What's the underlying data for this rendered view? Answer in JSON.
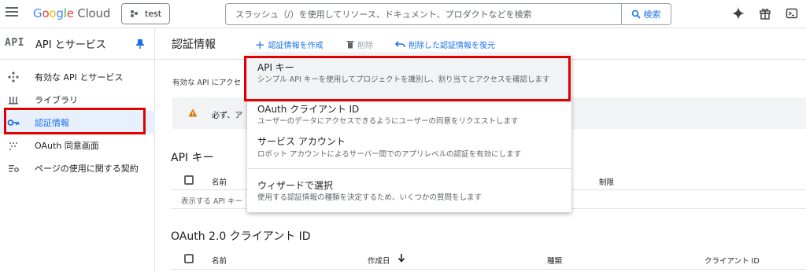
{
  "header": {
    "logo": {
      "G": "G",
      "o1": "o",
      "o2": "o",
      "g": "g",
      "l": "l",
      "e": "e",
      "cloud": "Cloud"
    },
    "project": "test",
    "search_placeholder": "スラッシュ（/）を使用してリソース、ドキュメント、プロダクトなどを検索",
    "search_button": "検索"
  },
  "sidebar": {
    "logo": "API",
    "title": "API とサービス",
    "items": [
      {
        "label": "有効な API とサービス",
        "icon": "api-diamond-icon"
      },
      {
        "label": "ライブラリ",
        "icon": "library-icon"
      },
      {
        "label": "認証情報",
        "icon": "key-icon"
      },
      {
        "label": "OAuth 同意画面",
        "icon": "oauth-icon"
      },
      {
        "label": "ページの使用に関する契約",
        "icon": "settings-list-icon"
      }
    ]
  },
  "main": {
    "title": "認証情報",
    "toolbar": {
      "create": "認証情報を作成",
      "delete": "削除",
      "restore": "削除した認証情報を復元"
    },
    "description": "有効な API にアクセ",
    "warning": "必ず、ア",
    "api_keys_section": {
      "title": "API キー",
      "columns": [
        "名前",
        "制限"
      ],
      "empty": "表示する API キー"
    },
    "oauth_section": {
      "title": "OAuth 2.0 クライアント ID",
      "columns": [
        "名前",
        "作成日",
        "種類",
        "クライアント ID"
      ]
    }
  },
  "dropdown": {
    "items": [
      {
        "title": "API キー",
        "desc": "シンプル API キーを使用してプロジェクトを識別し、割り当てとアクセスを確認します"
      },
      {
        "title": "OAuth クライアント ID",
        "desc": "ユーザーのデータにアクセスできるようにユーザーの同意をリクエストします"
      },
      {
        "title": "サービス アカウント",
        "desc": "ロボット アカウントによるサーバー間でのアプリレベルの認証を有効にします"
      },
      {
        "title": "ウィザードで選択",
        "desc": "使用する認証情報の種類を決定するため、いくつかの質問をします"
      }
    ]
  },
  "colors": {
    "accent": "#1a73e8",
    "highlight": "#e00000",
    "active_bg": "#e8f0fe"
  }
}
